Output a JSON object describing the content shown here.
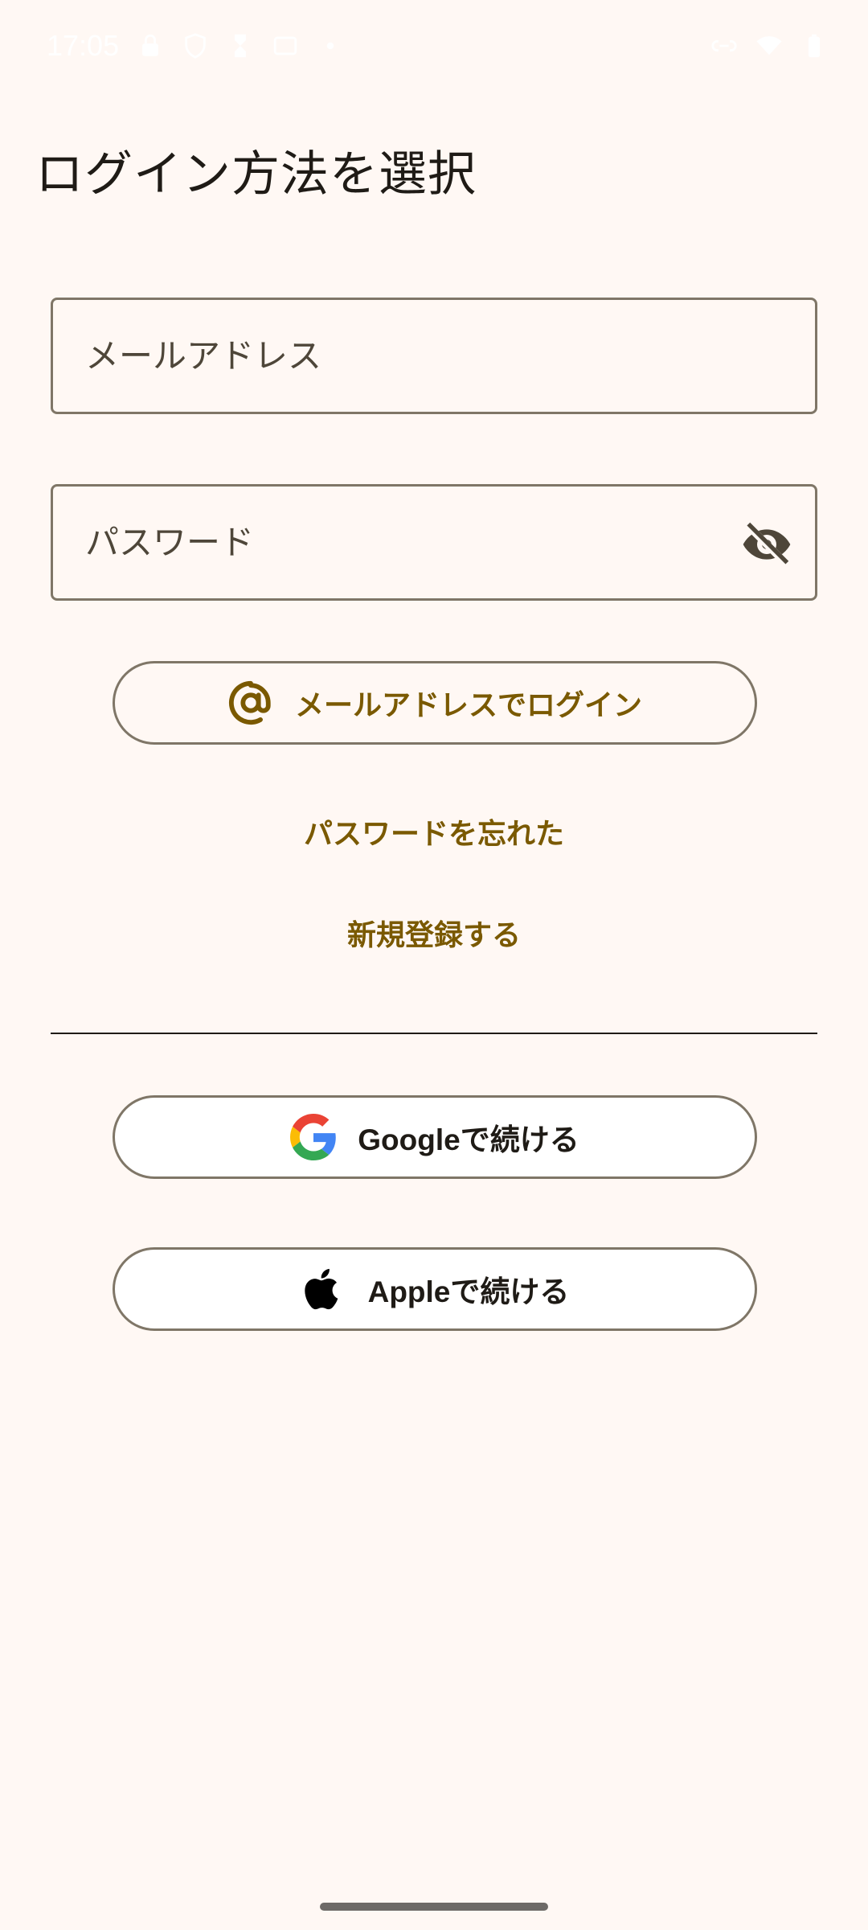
{
  "status_bar": {
    "time": "17:05",
    "left_icons": [
      "lock-icon",
      "shield-icon",
      "hourglass-icon",
      "card-icon",
      "dot-icon"
    ],
    "right_icons": [
      "link-icon",
      "wifi-icon",
      "battery-icon"
    ]
  },
  "page": {
    "title": "ログイン方法を選択"
  },
  "form": {
    "email_placeholder": "メールアドレス",
    "email_value": "",
    "password_placeholder": "パスワード",
    "password_value": "",
    "password_toggle_icon": "visibility-off-icon"
  },
  "actions": {
    "email_login_label": "メールアドレスでログイン",
    "forgot_password_label": "パスワードを忘れた",
    "signup_label": "新規登録する",
    "google_label": "Googleで続ける",
    "apple_label": "Appleで続ける"
  },
  "colors": {
    "background": "#FFF8F4",
    "accent": "#7A5900",
    "outline": "#7F7667",
    "text": "#1F1B16"
  }
}
